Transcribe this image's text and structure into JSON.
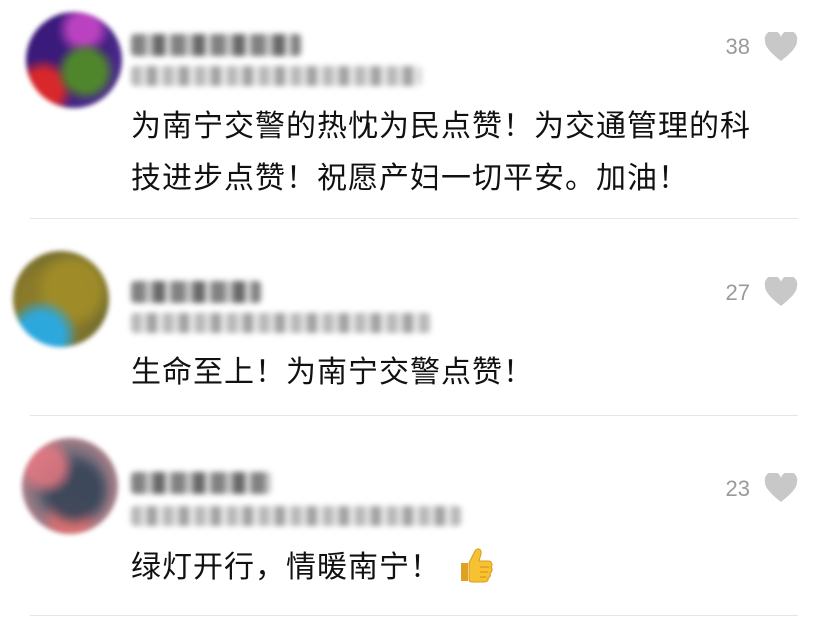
{
  "comments": [
    {
      "likes": "38",
      "text": "为南宁交警的热忱为民点赞！为交通管理的科技进步点赞！祝愿产妇一切平安。加油！",
      "line1": "为南宁交警的热忱为民点赞！为交通管理的科",
      "line2": "技进步点赞！祝愿产妇一切平安。加油！"
    },
    {
      "likes": "27",
      "text": "生命至上！为南宁交警点赞！"
    },
    {
      "likes": "23",
      "text": "绿灯开行，情暖南宁！",
      "emoji": "thumbs-up-icon"
    }
  ],
  "colors": {
    "like_count": "#9a9a9a",
    "heart": "#c8c8c8",
    "text": "#111111",
    "divider": "#e5e5e5"
  }
}
